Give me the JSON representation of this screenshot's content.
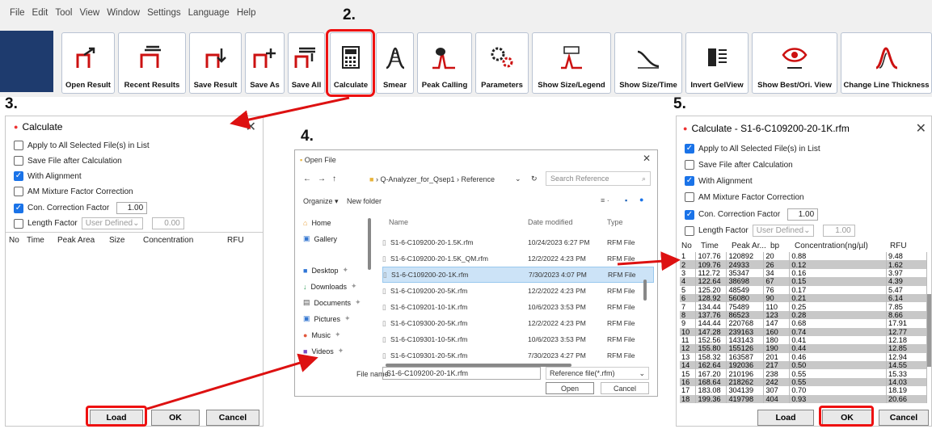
{
  "menu": [
    "File",
    "Edit",
    "Tool",
    "View",
    "Window",
    "Settings",
    "Language",
    "Help"
  ],
  "toolbar": [
    {
      "label": "Open Result",
      "icon": "open-result-icon"
    },
    {
      "label": "Recent Results",
      "icon": "recent-results-icon"
    },
    {
      "label": "Save Result",
      "icon": "save-result-icon"
    },
    {
      "label": "Save As",
      "icon": "save-as-icon"
    },
    {
      "label": "Save All",
      "icon": "save-all-icon"
    },
    {
      "label": "Calculate",
      "icon": "calculator-icon"
    },
    {
      "label": "Smear",
      "icon": "smear-icon"
    },
    {
      "label": "Peak Calling",
      "icon": "peak-calling-icon"
    },
    {
      "label": "Parameters",
      "icon": "gears-icon"
    },
    {
      "label": "Show Size/Legend",
      "icon": "size-legend-icon"
    },
    {
      "label": "Show Size/Time",
      "icon": "size-time-icon"
    },
    {
      "label": "Invert GelView",
      "icon": "invert-gelview-icon"
    },
    {
      "label": "Show Best/Ori. View",
      "icon": "eye-icon"
    },
    {
      "label": "Change Line Thickness",
      "icon": "line-thickness-icon"
    }
  ],
  "steps": {
    "s2": "2.",
    "s3": "3.",
    "s4": "4.",
    "s5": "5."
  },
  "calc1": {
    "title": "Calculate",
    "apply": "Apply to All Selected File(s) in List",
    "save": "Save File after Calculation",
    "align": "With Alignment",
    "am": "AM Mixture Factor Correction",
    "con": "Con. Correction Factor",
    "con_val": "1.00",
    "len": "Length Factor",
    "len_sel": "User Defined",
    "len_val": "0.00",
    "headers": [
      "No",
      "Time",
      "Peak Area",
      "Size",
      "Concentration",
      "RFU"
    ],
    "load": "Load",
    "ok": "OK",
    "cancel": "Cancel"
  },
  "open": {
    "title": "Open File",
    "path": [
      "Q-Analyzer_for_Qsep1",
      "Reference"
    ],
    "search_ph": "Search Reference",
    "organize": "Organize ▾",
    "newfolder": "New folder",
    "cols": [
      "Name",
      "Date modified",
      "Type"
    ],
    "side": [
      "Home",
      "Gallery",
      "Desktop",
      "Downloads",
      "Documents",
      "Pictures",
      "Music",
      "Videos"
    ],
    "files": [
      {
        "name": "S1-6-C109200-20-1.5K.rfm",
        "date": "10/24/2023 6:27 PM",
        "type": "RFM File"
      },
      {
        "name": "S1-6-C109200-20-1.5K_QM.rfm",
        "date": "12/2/2022 4:23 PM",
        "type": "RFM File"
      },
      {
        "name": "S1-6-C109200-20-1K.rfm",
        "date": "7/30/2023 4:07 PM",
        "type": "RFM File"
      },
      {
        "name": "S1-6-C109200-20-5K.rfm",
        "date": "12/2/2022 4:23 PM",
        "type": "RFM File"
      },
      {
        "name": "S1-6-C109201-10-1K.rfm",
        "date": "10/6/2023 3:53 PM",
        "type": "RFM File"
      },
      {
        "name": "S1-6-C109300-20-5K.rfm",
        "date": "12/2/2022 4:23 PM",
        "type": "RFM File"
      },
      {
        "name": "S1-6-C109301-10-5K.rfm",
        "date": "10/6/2023 3:53 PM",
        "type": "RFM File"
      },
      {
        "name": "S1-6-C109301-20-5K.rfm",
        "date": "7/30/2023 4:27 PM",
        "type": "RFM File"
      }
    ],
    "fname_label": "File name:",
    "fname": "S1-6-C109200-20-1K.rfm",
    "filter": "Reference file(*.rfm)",
    "open": "Open",
    "cancel": "Cancel"
  },
  "calc2": {
    "title": "Calculate - S1-6-C109200-20-1K.rfm",
    "apply": "Apply to All Selected File(s) in List",
    "save": "Save File after Calculation",
    "align": "With Alignment",
    "am": "AM Mixture Factor Correction",
    "con": "Con. Correction Factor",
    "con_val": "1.00",
    "len": "Length Factor",
    "len_sel": "User Defined",
    "len_val": "1.00",
    "headers": [
      "No",
      "Time",
      "Peak Ar...",
      "bp",
      "Concentration(ng/µl)",
      "RFU"
    ],
    "rows": [
      [
        "1",
        "107.76",
        "120892",
        "20",
        "0.88",
        "9.48"
      ],
      [
        "2",
        "109.76",
        "24933",
        "26",
        "0.12",
        "1.62"
      ],
      [
        "3",
        "112.72",
        "35347",
        "34",
        "0.16",
        "3.97"
      ],
      [
        "4",
        "122.64",
        "38698",
        "67",
        "0.15",
        "4.39"
      ],
      [
        "5",
        "125.20",
        "48549",
        "76",
        "0.17",
        "5.47"
      ],
      [
        "6",
        "128.92",
        "56080",
        "90",
        "0.21",
        "6.14"
      ],
      [
        "7",
        "134.44",
        "75489",
        "110",
        "0.25",
        "7.85"
      ],
      [
        "8",
        "137.76",
        "86523",
        "123",
        "0.28",
        "8.66"
      ],
      [
        "9",
        "144.44",
        "220768",
        "147",
        "0.68",
        "17.91"
      ],
      [
        "10",
        "147.28",
        "239163",
        "160",
        "0.74",
        "12.77"
      ],
      [
        "11",
        "152.56",
        "143143",
        "180",
        "0.41",
        "12.18"
      ],
      [
        "12",
        "155.80",
        "155126",
        "190",
        "0.44",
        "12.85"
      ],
      [
        "13",
        "158.32",
        "163587",
        "201",
        "0.46",
        "12.94"
      ],
      [
        "14",
        "162.64",
        "192036",
        "217",
        "0.50",
        "14.55"
      ],
      [
        "15",
        "167.20",
        "210196",
        "238",
        "0.55",
        "15.33"
      ],
      [
        "16",
        "168.64",
        "218262",
        "242",
        "0.55",
        "14.03"
      ],
      [
        "17",
        "183.08",
        "304139",
        "307",
        "0.70",
        "18.19"
      ],
      [
        "18",
        "199.36",
        "419798",
        "404",
        "0.93",
        "20.66"
      ]
    ],
    "load": "Load",
    "ok": "OK",
    "cancel": "Cancel"
  }
}
